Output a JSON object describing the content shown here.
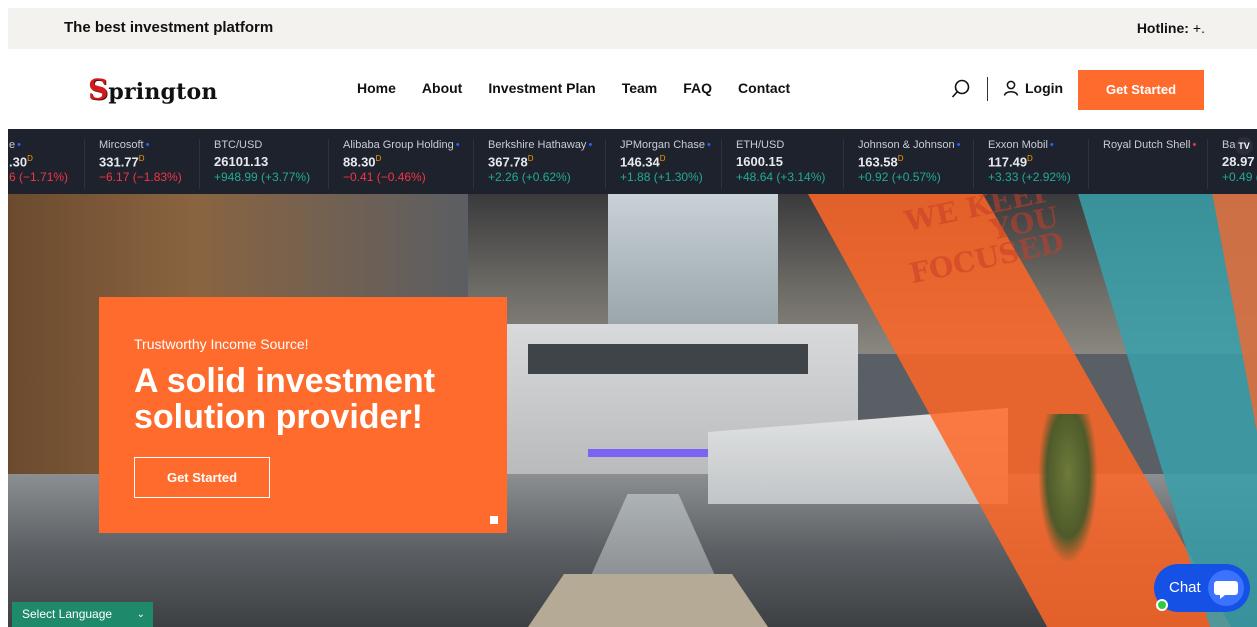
{
  "topbar": {
    "tagline": "The best investment platform",
    "hotline_label": "Hotline:",
    "hotline_number": "+."
  },
  "header": {
    "logo_initial": "S",
    "logo_rest": "prington",
    "nav": [
      "Home",
      "About",
      "Investment Plan",
      "Team",
      "FAQ",
      "Contact"
    ],
    "login_label": "Login",
    "cta_label": "Get Started"
  },
  "ticker": [
    {
      "name": "e",
      "price": ".30",
      "sup": "D",
      "change": "6 (−1.71%)",
      "dir": "down",
      "dot": "blue"
    },
    {
      "name": "Mircosoft",
      "price": "331.77",
      "sup": "D",
      "change": "−6.17 (−1.83%)",
      "dir": "down",
      "dot": "blue"
    },
    {
      "name": "BTC/USD",
      "price": "26101.13",
      "sup": "",
      "change": "+948.99 (+3.77%)",
      "dir": "up",
      "dot": ""
    },
    {
      "name": "Alibaba Group Holding",
      "price": "88.30",
      "sup": "D",
      "change": "−0.41 (−0.46%)",
      "dir": "down",
      "dot": "blue"
    },
    {
      "name": "Berkshire Hathaway",
      "price": "367.78",
      "sup": "D",
      "change": "+2.26 (+0.62%)",
      "dir": "up",
      "dot": "blue"
    },
    {
      "name": "JPMorgan Chase",
      "price": "146.34",
      "sup": "D",
      "change": "+1.88 (+1.30%)",
      "dir": "up",
      "dot": "blue"
    },
    {
      "name": "ETH/USD",
      "price": "1600.15",
      "sup": "",
      "change": "+48.64 (+3.14%)",
      "dir": "up",
      "dot": ""
    },
    {
      "name": "Johnson & Johnson",
      "price": "163.58",
      "sup": "D",
      "change": "+0.92 (+0.57%)",
      "dir": "up",
      "dot": "blue"
    },
    {
      "name": "Exxon Mobil",
      "price": "117.49",
      "sup": "D",
      "change": "+3.33 (+2.92%)",
      "dir": "up",
      "dot": "blue"
    },
    {
      "name": "Royal Dutch Shell",
      "price": "",
      "sup": "",
      "change": "",
      "dir": "up",
      "dot": "red"
    },
    {
      "name": "Bar",
      "price": "28.97",
      "sup": "",
      "change": "+0.49 (",
      "dir": "up",
      "dot": ""
    }
  ],
  "ticker_logo": "TV",
  "hero": {
    "wall_text": "WE KEEP\nYOU\nFOCUSED",
    "eyebrow": "Trustworthy Income Source!",
    "headline": "A solid investment solution provider!",
    "cta_label": "Get Started"
  },
  "language": {
    "label": "Select Language"
  },
  "chat": {
    "label": "Chat"
  },
  "colors": {
    "accent": "#ff6b2c",
    "ticker_bg": "#1e222d",
    "up": "#22ab94",
    "down": "#f23645",
    "chat": "#1551e5",
    "language": "#1f8a6b"
  }
}
